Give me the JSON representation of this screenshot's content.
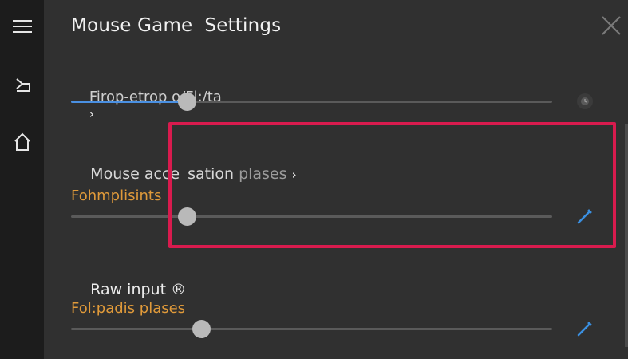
{
  "title": "Mouse Game  Settings",
  "sections": [
    {
      "label": "Firop-etrop o/Fl:/ta",
      "chevron": "›",
      "slider_value": 0.24,
      "fill_color": "#4a90e2",
      "side_icon": "clock-icon"
    },
    {
      "label_part1": "Mouse acce",
      "label_part2": "sation",
      "label_part3": "plases",
      "chevron": "›",
      "sublabel": "Fohmplisints",
      "slider_value": 0.24,
      "side_icon": "pen-icon"
    },
    {
      "label": "Raw input",
      "badge": "®",
      "sublabel": "Fol:padis plases",
      "slider_value": 0.27,
      "side_icon": "pen-icon"
    }
  ],
  "colors": {
    "accent_orange": "#e09a3a",
    "highlight": "#d81b4e",
    "slider_fill": "#4a90e2"
  },
  "rail_icons": [
    "menu-icon",
    "share-arrow-icon",
    "home-icon"
  ],
  "close_icon": "close-icon"
}
